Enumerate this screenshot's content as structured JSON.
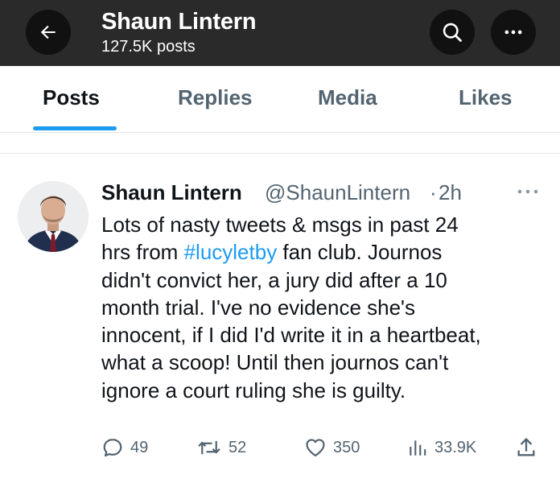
{
  "header": {
    "name": "Shaun Lintern",
    "post_count": "127.5K posts",
    "back_icon": "back-arrow-icon",
    "search_icon": "search-icon",
    "more_icon": "more-horizontal-icon",
    "background": "#2b2a2a"
  },
  "tabs": [
    "Posts",
    "Replies",
    "Media",
    "Likes"
  ],
  "active_tab": "Posts",
  "accent_color": "#1d9bf0",
  "tweet": {
    "author": "Shaun Lintern",
    "handle": "@ShaunLintern",
    "separator": "·",
    "time": "2h",
    "lines": [
      {
        "before": "Lots of nasty tweets & msgs in past 24",
        "hashtag": "",
        "after": ""
      },
      {
        "before": "hrs from ",
        "hashtag": "#lucyletby",
        "after": " fan club. Journos"
      },
      {
        "before": "didn't convict her, a jury did after a 10",
        "hashtag": "",
        "after": ""
      },
      {
        "before": "month trial. I've no evidence she's",
        "hashtag": "",
        "after": ""
      },
      {
        "before": "innocent, if I did I'd write it in a heartbeat,",
        "hashtag": "",
        "after": ""
      },
      {
        "before": "what a scoop! Until then journos can't",
        "hashtag": "",
        "after": ""
      },
      {
        "before": "ignore a court ruling she is guilty.",
        "hashtag": "",
        "after": ""
      }
    ],
    "actions": {
      "replies": "49",
      "reposts": "52",
      "likes": "350",
      "views": "33.9K"
    }
  }
}
